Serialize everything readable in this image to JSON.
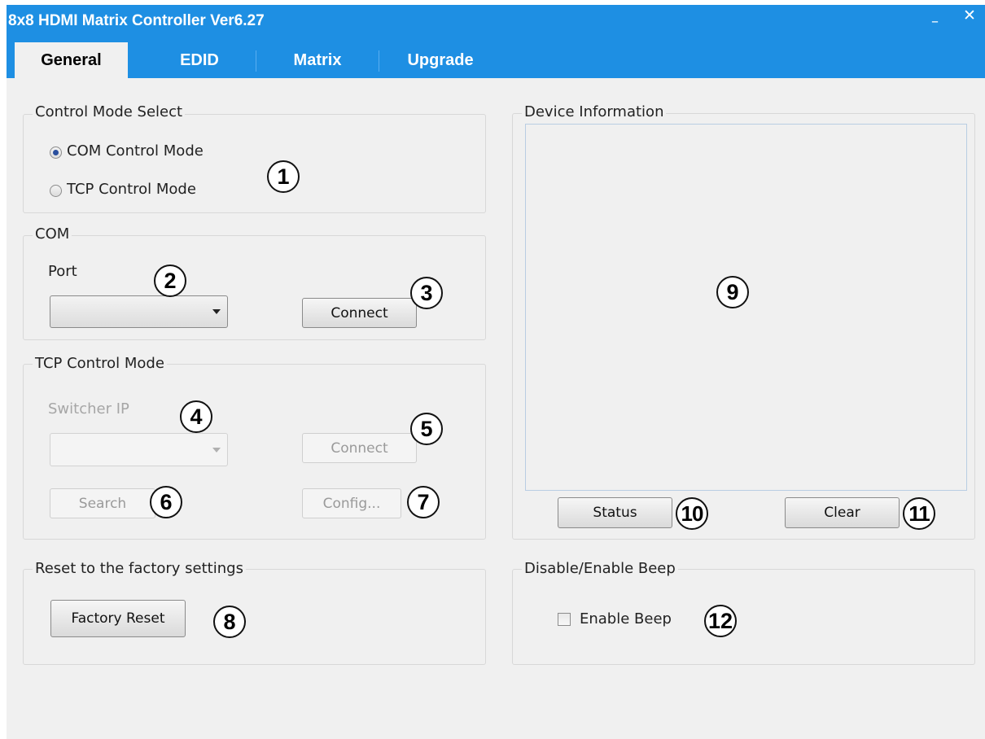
{
  "window": {
    "title": "8x8 HDMI Matrix Controller Ver6.27",
    "minimize_glyph": "–",
    "close_glyph": "✕"
  },
  "tabs": [
    {
      "label": "General",
      "active": true
    },
    {
      "label": "EDID",
      "active": false
    },
    {
      "label": "Matrix",
      "active": false
    },
    {
      "label": "Upgrade",
      "active": false
    }
  ],
  "control_mode": {
    "legend": "Control Mode Select",
    "options": [
      {
        "label": "COM Control Mode",
        "checked": true
      },
      {
        "label": "TCP Control Mode",
        "checked": false
      }
    ]
  },
  "com": {
    "legend": "COM",
    "port_label": "Port",
    "port_value": "",
    "connect_label": "Connect"
  },
  "tcp": {
    "legend": "TCP Control Mode",
    "ip_label": "Switcher IP",
    "ip_value": "",
    "connect_label": "Connect",
    "search_label": "Search",
    "config_label": "Config..."
  },
  "reset": {
    "legend": "Reset to the factory settings",
    "button_label": "Factory Reset"
  },
  "device_info": {
    "legend": "Device Information",
    "status_label": "Status",
    "clear_label": "Clear"
  },
  "beep": {
    "legend": "Disable/Enable Beep",
    "checkbox_label": "Enable Beep",
    "checked": false
  },
  "callouts": [
    "1",
    "2",
    "3",
    "4",
    "5",
    "6",
    "7",
    "8",
    "9",
    "10",
    "11",
    "12"
  ]
}
